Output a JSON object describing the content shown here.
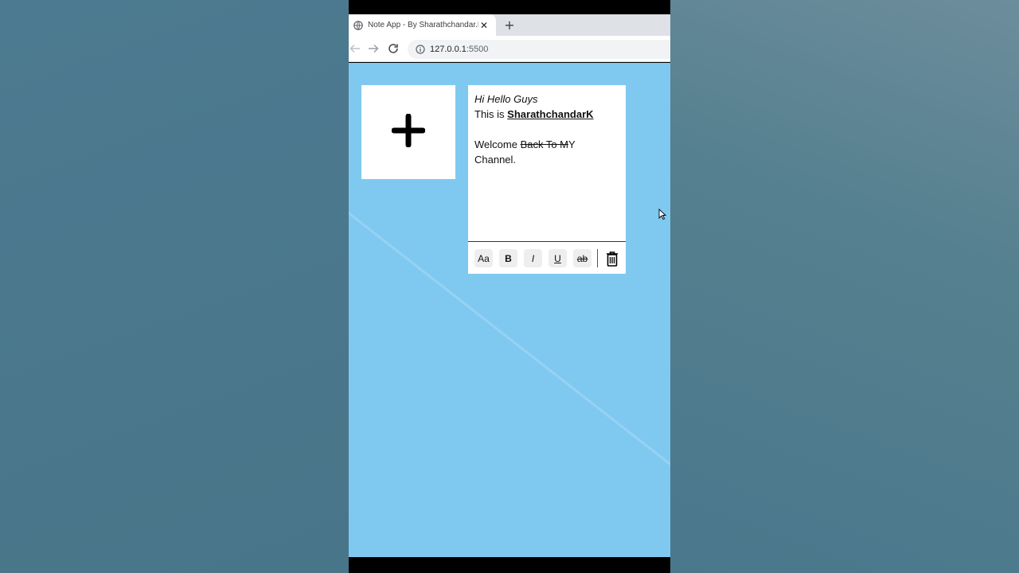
{
  "browser": {
    "tab_title": "Note App - By Sharathchandar.K",
    "close_glyph": "✕",
    "newtab_glyph": "+",
    "url_host": "127.0.0.1",
    "url_port": ":5500"
  },
  "note": {
    "line1": "Hi Hello Guys",
    "line2_prefix": "This is ",
    "line2_name": "SharathchandarK",
    "line3_prefix": "Welcome ",
    "line3_strike": "Back To M",
    "line3_suffix": "Y",
    "line4": "Channel."
  },
  "tools": {
    "font": "Aa",
    "bold": "B",
    "italic": "I",
    "underline": "U",
    "strike": "ab"
  },
  "colors": {
    "page_bg": "#7fc9f1",
    "card_bg": "#ffffff"
  },
  "icons": [
    "globe-icon",
    "back-arrow-icon",
    "forward-arrow-icon",
    "reload-icon",
    "info-icon",
    "plus-icon",
    "trash-icon"
  ]
}
